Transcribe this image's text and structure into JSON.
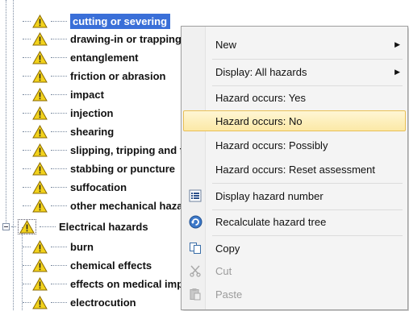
{
  "tree": {
    "items": [
      {
        "label": "cutting or severing",
        "selected": true
      },
      {
        "label": "drawing-in or trapping"
      },
      {
        "label": "entanglement"
      },
      {
        "label": "friction or abrasion"
      },
      {
        "label": "impact"
      },
      {
        "label": "injection"
      },
      {
        "label": "shearing"
      },
      {
        "label": "slipping, tripping and falling"
      },
      {
        "label": "stabbing or puncture"
      },
      {
        "label": "suffocation"
      },
      {
        "label": "other mechanical hazards"
      }
    ],
    "group": {
      "label": "Electrical hazards"
    },
    "children": [
      {
        "label": "burn"
      },
      {
        "label": "chemical effects"
      },
      {
        "label": "effects on medical implants"
      },
      {
        "label": "electrocution"
      }
    ]
  },
  "context_menu": {
    "new": "New",
    "display_all": "Display: All hazards",
    "occurs_yes": "Hazard occurs: Yes",
    "occurs_no": "Hazard occurs: No",
    "occurs_possibly": "Hazard occurs: Possibly",
    "occurs_reset": "Hazard occurs: Reset assessment",
    "display_number": "Display hazard number",
    "recalculate": "Recalculate hazard tree",
    "copy": "Copy",
    "cut": "Cut",
    "paste": "Paste"
  },
  "colors": {
    "selection": "#3a6fd8",
    "menu_highlight": "#fce9a6",
    "warning_yellow": "#f2d21b"
  }
}
